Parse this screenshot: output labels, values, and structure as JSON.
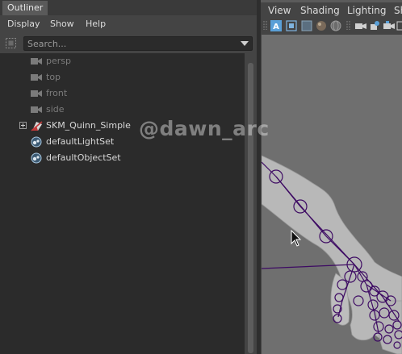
{
  "outliner": {
    "tab_label": "Outliner",
    "menu": [
      "Display",
      "Show",
      "Help"
    ],
    "search": {
      "placeholder": "Search..."
    },
    "items": [
      {
        "label": "persp",
        "icon": "camera-icon"
      },
      {
        "label": "top",
        "icon": "camera-icon"
      },
      {
        "label": "front",
        "icon": "camera-icon"
      },
      {
        "label": "side",
        "icon": "camera-icon"
      },
      {
        "label": "SKM_Quinn_Simple",
        "icon": "mesh-icon",
        "expandable": true
      },
      {
        "label": "defaultLightSet",
        "icon": "set-icon"
      },
      {
        "label": "defaultObjectSet",
        "icon": "set-icon"
      }
    ]
  },
  "viewport": {
    "menu": [
      "View",
      "Shading",
      "Lighting",
      "Sh"
    ],
    "toolbar_icons": [
      "camera-select-icon",
      "a-highlight-icon",
      "frame-icon",
      "grid-icon",
      "shaded-sphere-icon",
      "wire-sphere-icon",
      "xray-icon",
      "cam-attr-icon",
      "bookmark-icon",
      "cam-lock-icon",
      "gate-icon"
    ]
  },
  "watermark": {
    "text": "@dawn_arc"
  },
  "colors": {
    "panel": "#444444",
    "tree_bg": "#2b2b2b",
    "viewport_bg": "#6f6f6f",
    "joint": "#3d0a63",
    "accent_blue": "#5aa0d8"
  }
}
